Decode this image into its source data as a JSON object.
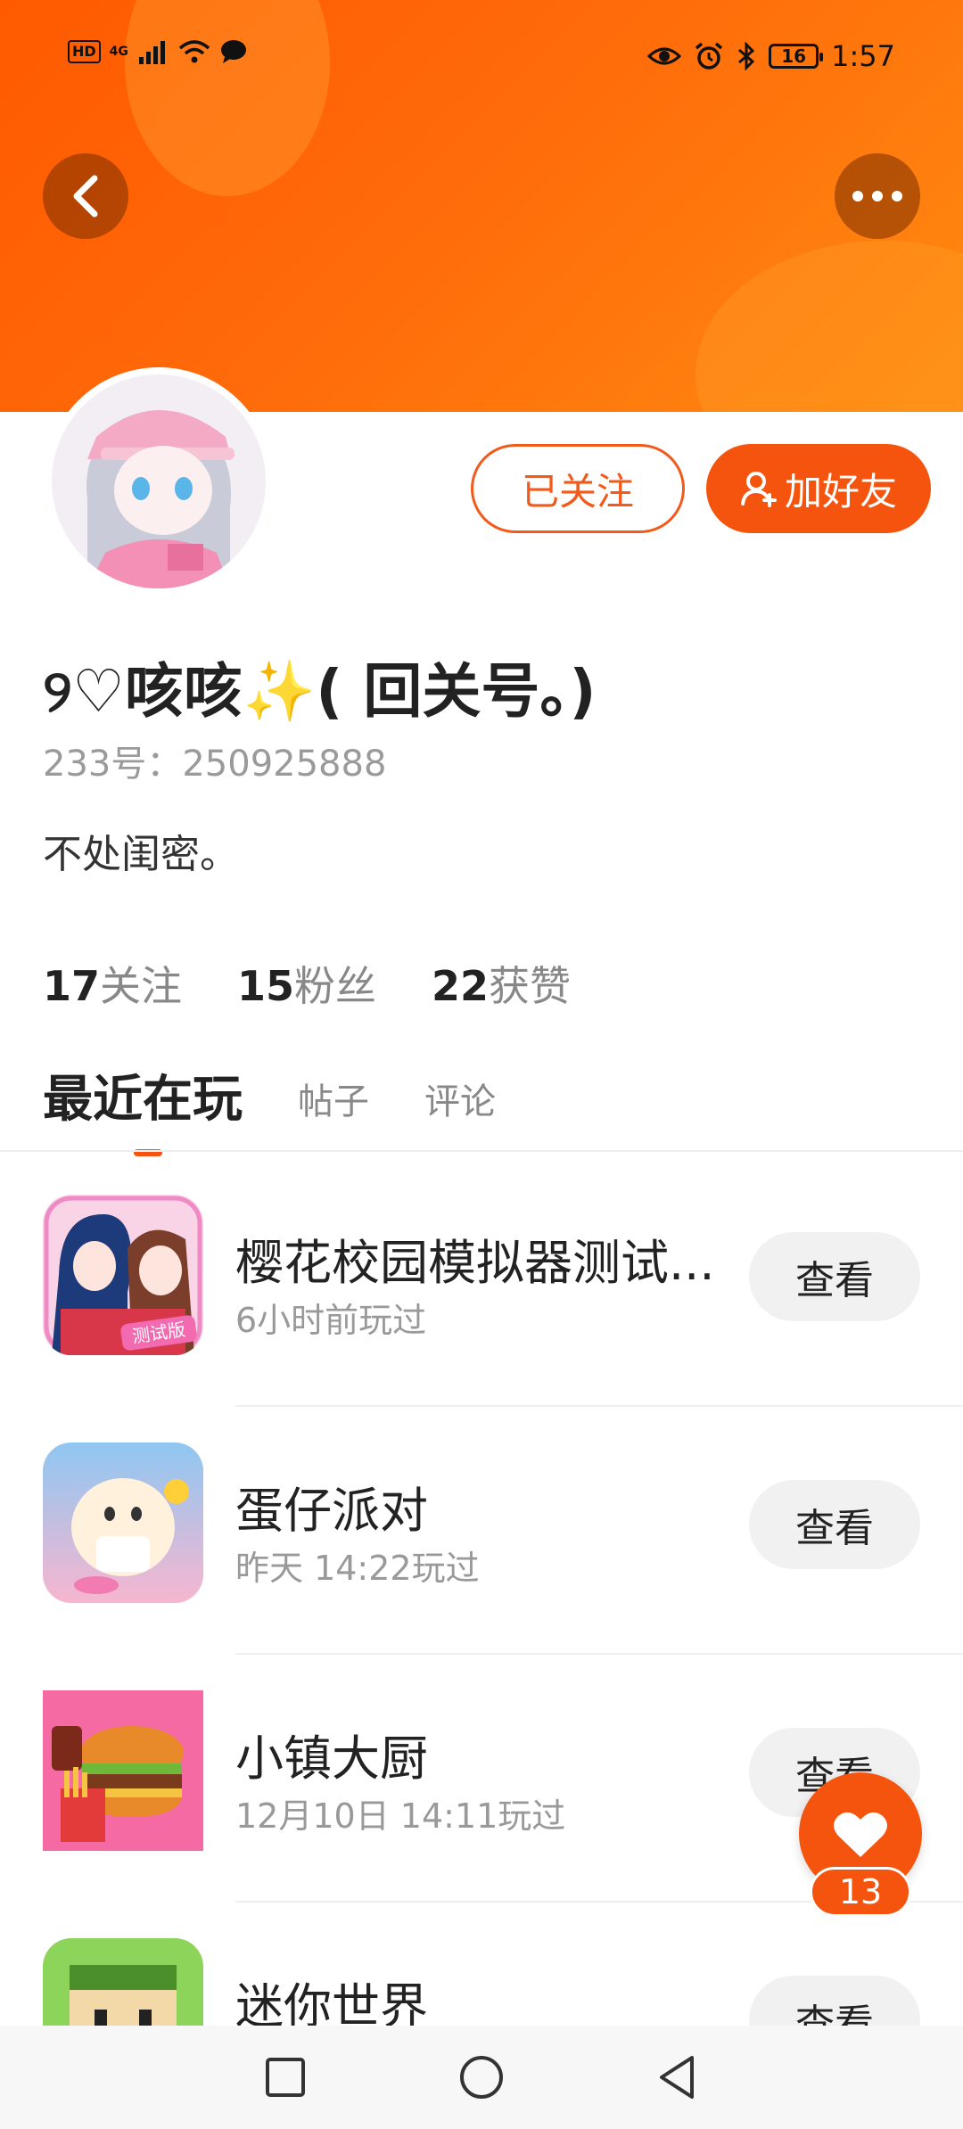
{
  "status_bar": {
    "hd": "HD",
    "network": "4G",
    "battery": "16",
    "time": "1:57"
  },
  "profile": {
    "nickname": "୨♡咳咳✨( 回关号。)",
    "uid": "233号：250925888",
    "bio": "不处闺密。",
    "followed_label": "已关注",
    "add_friend_label": "加好友",
    "stats": [
      {
        "num": "17",
        "label": "关注"
      },
      {
        "num": "15",
        "label": "粉丝"
      },
      {
        "num": "22",
        "label": "获赞"
      }
    ]
  },
  "tabs": {
    "active": "最近在玩",
    "posts": "帖子",
    "comments": "评论"
  },
  "games": [
    {
      "title": "樱花校园模拟器测试...",
      "sub": "6小时前玩过",
      "button": "查看",
      "icon_text": "测试版"
    },
    {
      "title": "蛋仔派对",
      "sub": "昨天 14:22玩过",
      "button": "查看"
    },
    {
      "title": "小镇大厨",
      "sub": "12月10日 14:11玩过",
      "button": "查看"
    },
    {
      "title": "迷你世界",
      "sub": "",
      "button": "查看"
    }
  ],
  "like": {
    "count": "13"
  },
  "colors": {
    "accent": "#f5540f",
    "banner_start": "#ff5a00",
    "banner_end": "#ff8a10"
  }
}
